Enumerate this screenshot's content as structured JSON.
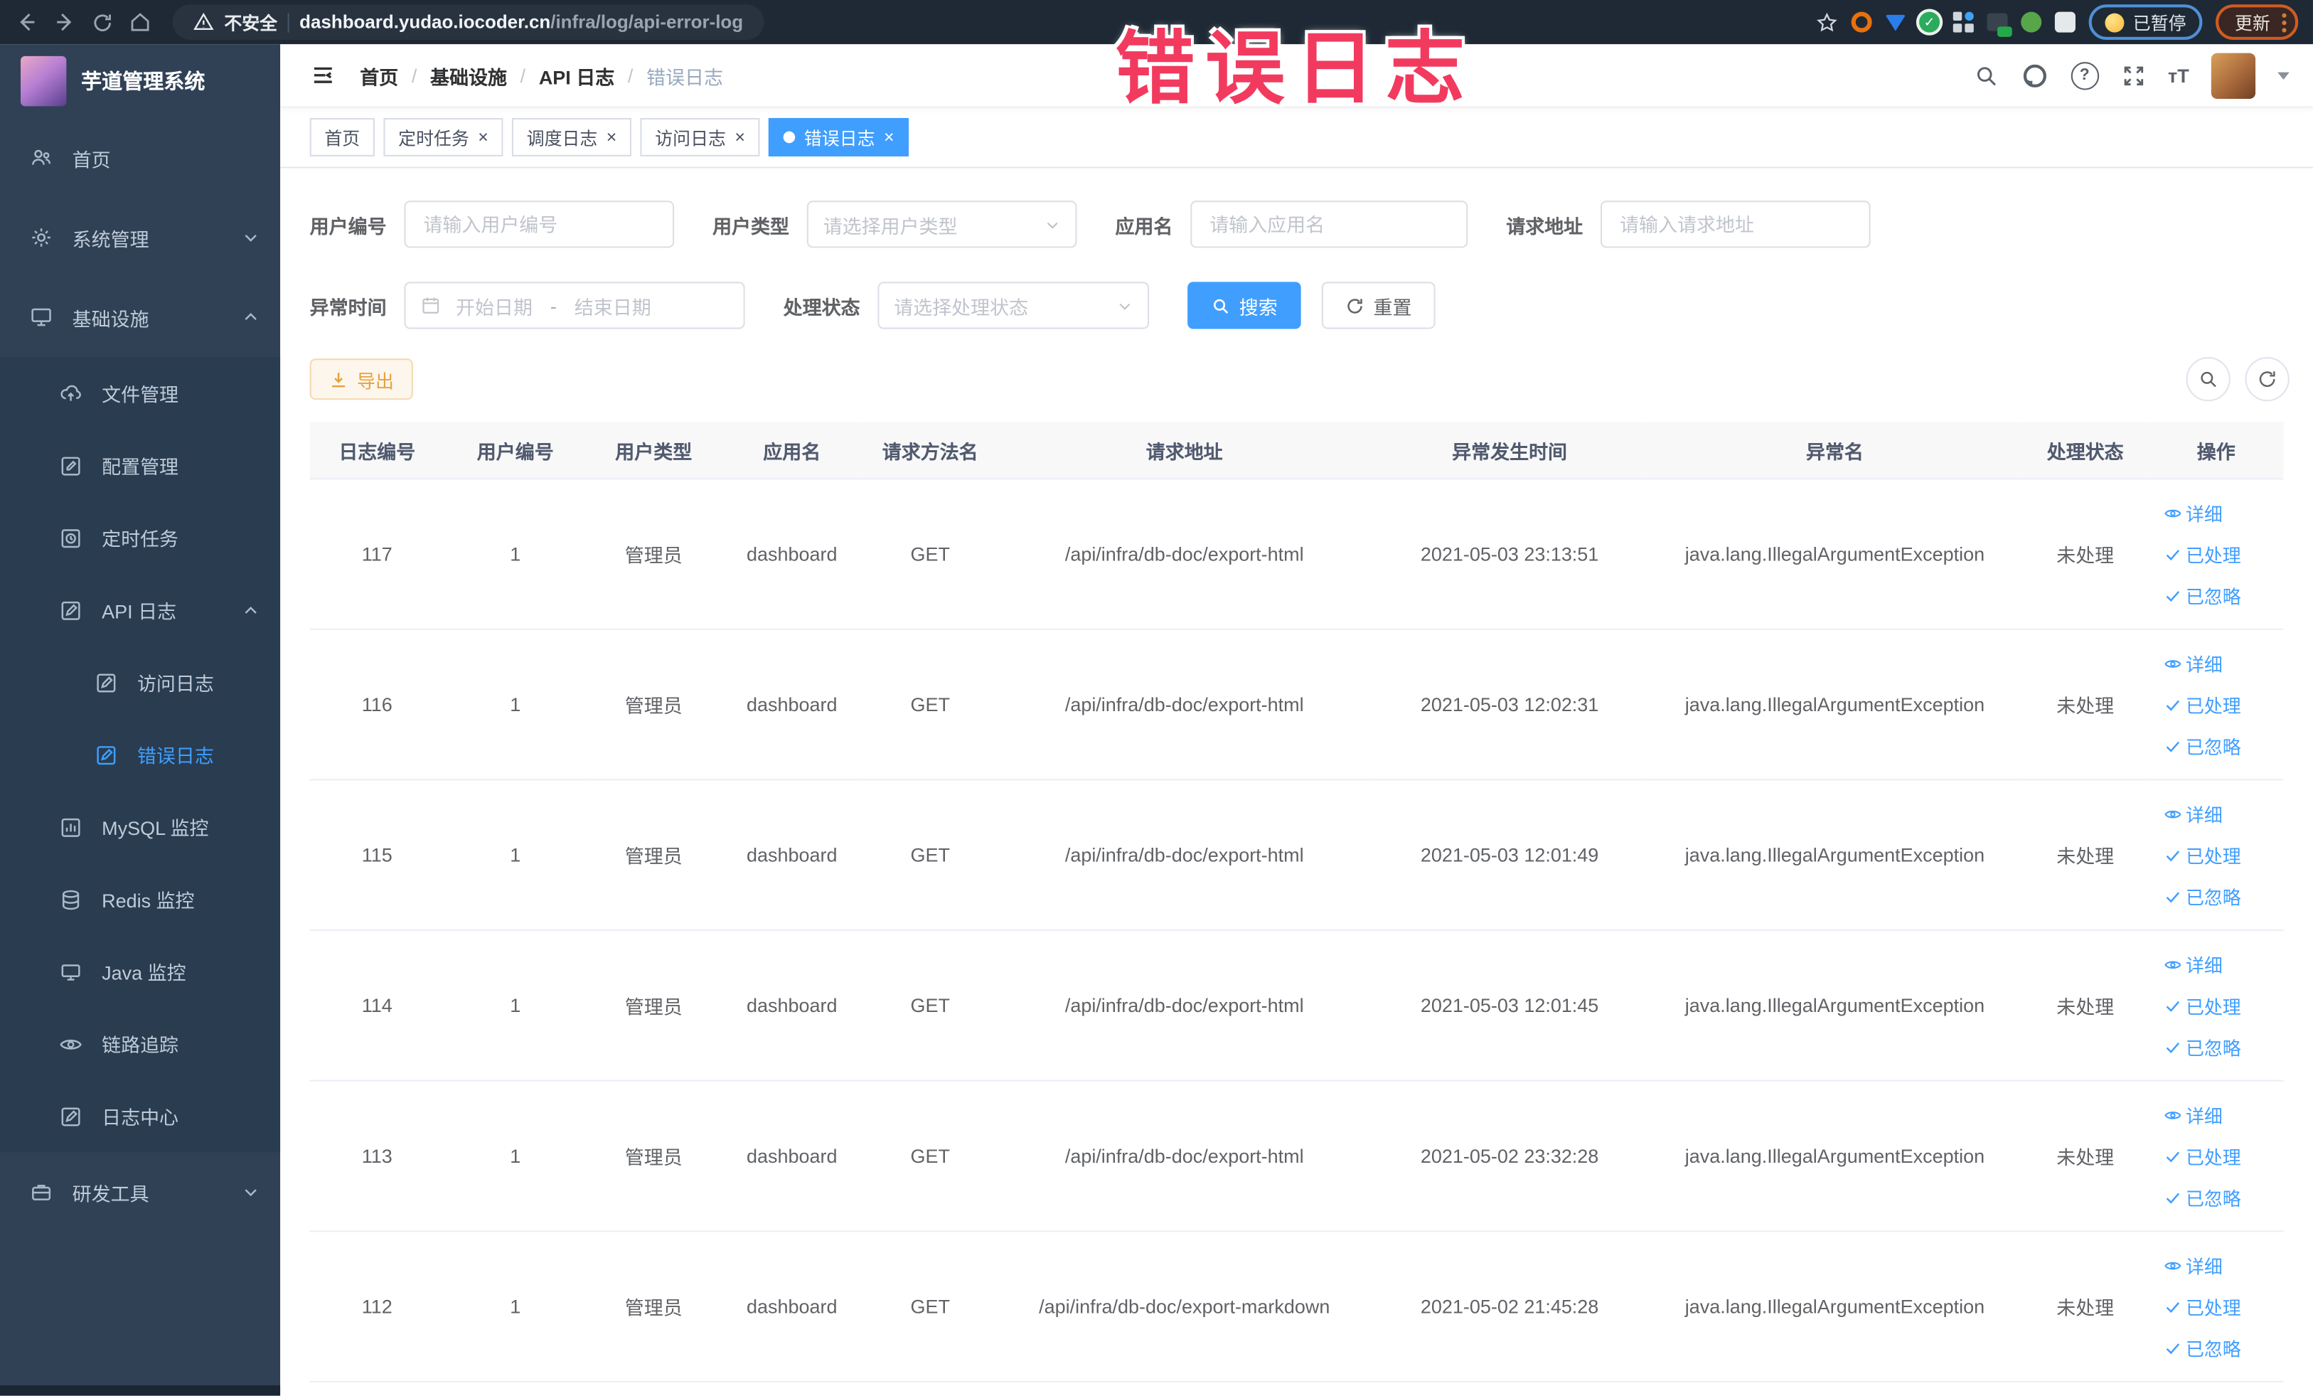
{
  "browser": {
    "insecure_label": "不安全",
    "url_host": "dashboard.yudao.iocoder.cn",
    "url_path": "/infra/log/api-error-log",
    "paused_label": "已暂停",
    "update_label": "更新"
  },
  "overlay": {
    "text": "错误日志"
  },
  "sidebar": {
    "title": "芋道管理系统",
    "items": [
      {
        "label": "首页"
      },
      {
        "label": "系统管理"
      },
      {
        "label": "基础设施"
      },
      {
        "label": "文件管理"
      },
      {
        "label": "配置管理"
      },
      {
        "label": "定时任务"
      },
      {
        "label": "API 日志"
      },
      {
        "label": "访问日志"
      },
      {
        "label": "错误日志"
      },
      {
        "label": "MySQL 监控"
      },
      {
        "label": "Redis 监控"
      },
      {
        "label": "Java 监控"
      },
      {
        "label": "链路追踪"
      },
      {
        "label": "日志中心"
      },
      {
        "label": "研发工具"
      }
    ]
  },
  "header": {
    "breadcrumb": [
      "首页",
      "基础设施",
      "API 日志",
      "错误日志"
    ]
  },
  "tabs": [
    {
      "label": "首页"
    },
    {
      "label": "定时任务"
    },
    {
      "label": "调度日志"
    },
    {
      "label": "访问日志"
    },
    {
      "label": "错误日志"
    }
  ],
  "filters": {
    "user_id": {
      "label": "用户编号",
      "placeholder": "请输入用户编号"
    },
    "user_type": {
      "label": "用户类型",
      "placeholder": "请选择用户类型"
    },
    "app_name": {
      "label": "应用名",
      "placeholder": "请输入应用名"
    },
    "req_url": {
      "label": "请求地址",
      "placeholder": "请输入请求地址"
    },
    "time": {
      "label": "异常时间",
      "start_placeholder": "开始日期",
      "separator": "-",
      "end_placeholder": "结束日期"
    },
    "status": {
      "label": "处理状态",
      "placeholder": "请选择处理状态"
    },
    "search_label": "搜索",
    "reset_label": "重置"
  },
  "toolbar": {
    "export_label": "导出"
  },
  "table": {
    "headers": [
      "日志编号",
      "用户编号",
      "用户类型",
      "应用名",
      "请求方法名",
      "请求地址",
      "异常发生时间",
      "异常名",
      "处理状态",
      "操作"
    ],
    "action_labels": [
      "详细",
      "已处理",
      "已忽略"
    ],
    "rows": [
      {
        "log_id": "117",
        "user_id": "1",
        "user_type": "管理员",
        "app_name": "dashboard",
        "method": "GET",
        "url": "/api/infra/db-doc/export-html",
        "time": "2021-05-03 23:13:51",
        "exception": "java.lang.IllegalArgumentException",
        "status": "未处理"
      },
      {
        "log_id": "116",
        "user_id": "1",
        "user_type": "管理员",
        "app_name": "dashboard",
        "method": "GET",
        "url": "/api/infra/db-doc/export-html",
        "time": "2021-05-03 12:02:31",
        "exception": "java.lang.IllegalArgumentException",
        "status": "未处理"
      },
      {
        "log_id": "115",
        "user_id": "1",
        "user_type": "管理员",
        "app_name": "dashboard",
        "method": "GET",
        "url": "/api/infra/db-doc/export-html",
        "time": "2021-05-03 12:01:49",
        "exception": "java.lang.IllegalArgumentException",
        "status": "未处理"
      },
      {
        "log_id": "114",
        "user_id": "1",
        "user_type": "管理员",
        "app_name": "dashboard",
        "method": "GET",
        "url": "/api/infra/db-doc/export-html",
        "time": "2021-05-03 12:01:45",
        "exception": "java.lang.IllegalArgumentException",
        "status": "未处理"
      },
      {
        "log_id": "113",
        "user_id": "1",
        "user_type": "管理员",
        "app_name": "dashboard",
        "method": "GET",
        "url": "/api/infra/db-doc/export-html",
        "time": "2021-05-02 23:32:28",
        "exception": "java.lang.IllegalArgumentException",
        "status": "未处理"
      },
      {
        "log_id": "112",
        "user_id": "1",
        "user_type": "管理员",
        "app_name": "dashboard",
        "method": "GET",
        "url": "/api/infra/db-doc/export-markdown",
        "time": "2021-05-02 21:45:28",
        "exception": "java.lang.IllegalArgumentException",
        "status": "未处理"
      }
    ]
  },
  "icons": {
    "search": "magnifier",
    "refresh": "circular-arrow",
    "export": "download-arrow",
    "detail": "eye",
    "handled": "check",
    "ignored": "check",
    "calendar": "calendar",
    "select_caret": "chevron-down",
    "breadcrumb_sep": "/",
    "tab_close": "×"
  },
  "colors": {
    "accent": "#409eff",
    "sidebar_bg": "#304156",
    "submenu_bg": "#293c50",
    "warning": "#e6a23c",
    "overlay_red": "#f23a5f",
    "browser_bar": "#1e2935",
    "table_header_bg": "#f8f8f9"
  }
}
